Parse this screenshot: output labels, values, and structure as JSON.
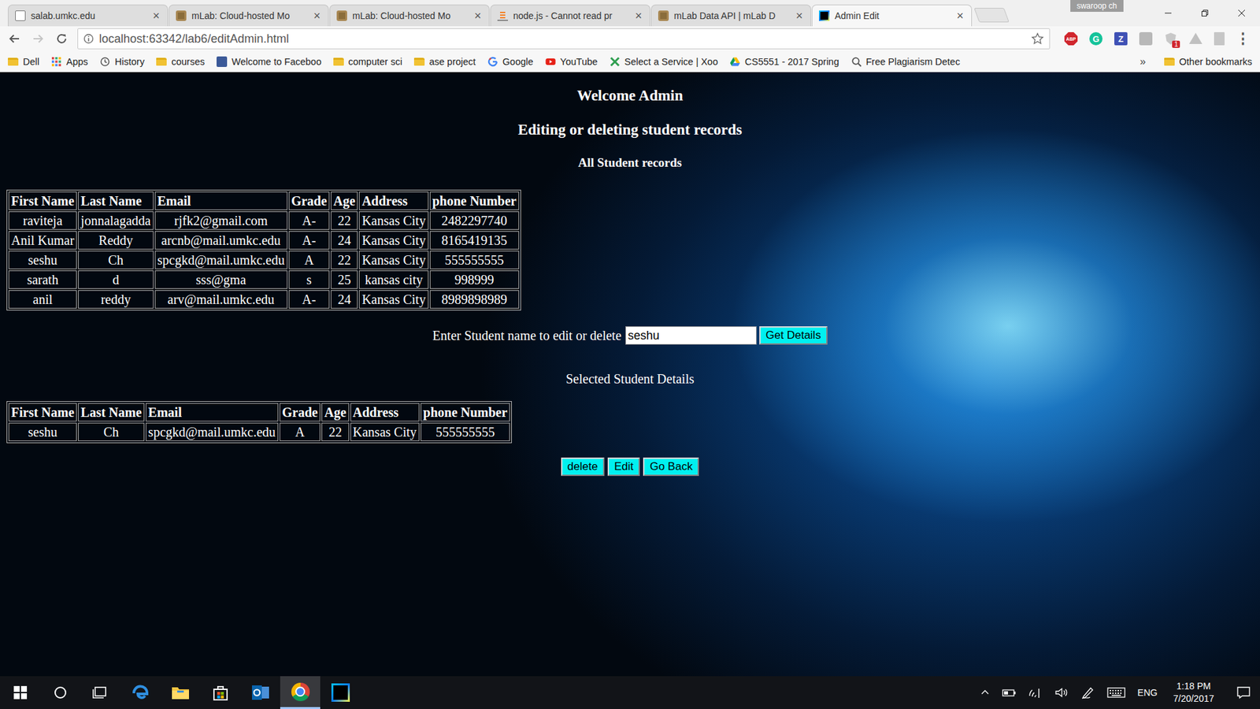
{
  "browser": {
    "tabs": [
      {
        "label": "salab.umkc.edu",
        "kind": "page",
        "close": "×",
        "selected": false
      },
      {
        "label": "mLab: Cloud-hosted Mo",
        "kind": "mlab",
        "close": "×",
        "selected": false
      },
      {
        "label": "mLab: Cloud-hosted Mo",
        "kind": "mlab",
        "close": "×",
        "selected": false
      },
      {
        "label": "node.js - Cannot read pr",
        "kind": "stackoverflow",
        "close": "×",
        "selected": false
      },
      {
        "label": "mLab Data API | mLab D",
        "kind": "mlab",
        "close": "×",
        "selected": false
      },
      {
        "label": "Admin Edit",
        "kind": "webstorm",
        "close": "×",
        "selected": true
      }
    ],
    "profile": "swaroop ch",
    "address": "localhost:63342/lab6/editAdmin.html",
    "starred": false,
    "extensions": [
      {
        "kind": "abp",
        "label": "ABP"
      },
      {
        "kind": "grammarly",
        "label": "G"
      },
      {
        "kind": "zotero",
        "label": "Z"
      },
      {
        "kind": "gray"
      },
      {
        "kind": "shield",
        "label": "1"
      },
      {
        "kind": "drive"
      },
      {
        "kind": "pdf"
      },
      {
        "kind": "menu",
        "label": "⋮"
      }
    ],
    "bookmarks": [
      {
        "label": "Dell",
        "kind": "folder"
      },
      {
        "label": "Apps",
        "kind": "apps"
      },
      {
        "label": "History",
        "kind": "history"
      },
      {
        "label": "courses",
        "kind": "folder"
      },
      {
        "label": "Welcome to Faceboo",
        "kind": "facebook"
      },
      {
        "label": "computer sci",
        "kind": "folder"
      },
      {
        "label": "ase project",
        "kind": "folder"
      },
      {
        "label": "Google",
        "kind": "google"
      },
      {
        "label": "YouTube",
        "kind": "youtube"
      },
      {
        "label": "Select a Service | Xoo",
        "kind": "xoo"
      },
      {
        "label": "CS5551 - 2017 Spring",
        "kind": "drive"
      },
      {
        "label": "Free Plagiarism Detec",
        "kind": "search"
      }
    ],
    "bookmarks_more": "»",
    "other_bookmarks": "Other bookmarks"
  },
  "page": {
    "title": "Welcome Admin",
    "subtitle": "Editing or deleting student records",
    "all_heading": "All Student records",
    "all_table": {
      "columns": [
        "First Name",
        "Last Name",
        "Email",
        "Grade",
        "Age",
        "Address",
        "phone Number"
      ],
      "rows": [
        [
          "raviteja",
          "jonnalagadda",
          "rjfk2@gmail.com",
          "A-",
          "22",
          "Kansas City",
          "2482297740"
        ],
        [
          "Anil Kumar",
          "Reddy",
          "arcnb@mail.umkc.edu",
          "A-",
          "24",
          "Kansas City",
          "8165419135"
        ],
        [
          "seshu",
          "Ch",
          "spcgkd@mail.umkc.edu",
          "A",
          "22",
          "Kansas City",
          "555555555"
        ],
        [
          "sarath",
          "d",
          "sss@gma",
          "s",
          "25",
          "kansas city",
          "998999"
        ],
        [
          "anil",
          "reddy",
          "arv@mail.umkc.edu",
          "A-",
          "24",
          "Kansas City",
          "8989898989"
        ]
      ]
    },
    "search": {
      "label": "Enter Student name to edit or delete",
      "value": "seshu",
      "button": "Get Details"
    },
    "selected_heading": "Selected Student Details",
    "selected_table": {
      "columns": [
        "First Name",
        "Last Name",
        "Email",
        "Grade",
        "Age",
        "Address",
        "phone Number"
      ],
      "rows": [
        [
          "seshu",
          "Ch",
          "spcgkd@mail.umkc.edu",
          "A",
          "22",
          "Kansas City",
          "555555555"
        ]
      ]
    },
    "actions": [
      "delete",
      "Edit",
      "Go Back"
    ]
  },
  "taskbar": {
    "apps": [
      {
        "kind": "edge",
        "selected": false
      },
      {
        "kind": "explorer",
        "selected": false
      },
      {
        "kind": "store",
        "selected": false
      },
      {
        "kind": "outlook",
        "selected": false
      },
      {
        "kind": "chrome",
        "selected": true
      },
      {
        "kind": "webstorm",
        "selected": false
      }
    ],
    "language": "ENG",
    "time": "1:18 PM",
    "date": "7/20/2017"
  }
}
